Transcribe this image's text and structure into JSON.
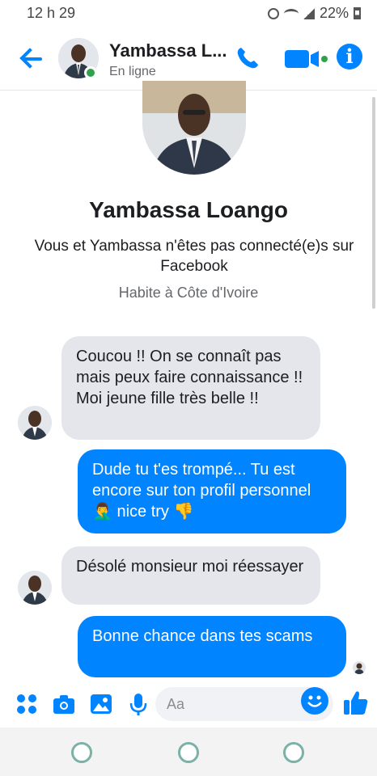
{
  "status_bar": {
    "time": "12 h 29",
    "battery": "22%"
  },
  "header": {
    "name": "Yambassa L...",
    "status": "En ligne"
  },
  "profile": {
    "name": "Yambassa Loango",
    "connection": "Vous et Yambassa n'êtes pas connecté(e)s sur Facebook",
    "lives": "Habite à Côte d'Ivoire"
  },
  "messages": [
    {
      "from": "them",
      "text": "Coucou !! On se connaît pas mais peux faire connaissance !! Moi jeune fille très belle !!"
    },
    {
      "from": "me",
      "text": "Dude tu t'es trompé... Tu est encore sur ton profil personnel 🤦‍♂️ nice try 👎"
    },
    {
      "from": "them",
      "text": "Désolé monsieur moi réessayer"
    },
    {
      "from": "me",
      "text": "Bonne chance dans tes scams"
    }
  ],
  "composer": {
    "placeholder": "Aa"
  },
  "colors": {
    "accent": "#0084ff",
    "incoming_bubble": "#e4e6eb",
    "online": "#31a24c"
  },
  "icons": [
    "back-arrow-icon",
    "phone-icon",
    "video-camera-icon",
    "info-icon",
    "apps-icon",
    "camera-icon",
    "gallery-icon",
    "microphone-icon",
    "emoji-icon",
    "thumbs-up-icon"
  ]
}
